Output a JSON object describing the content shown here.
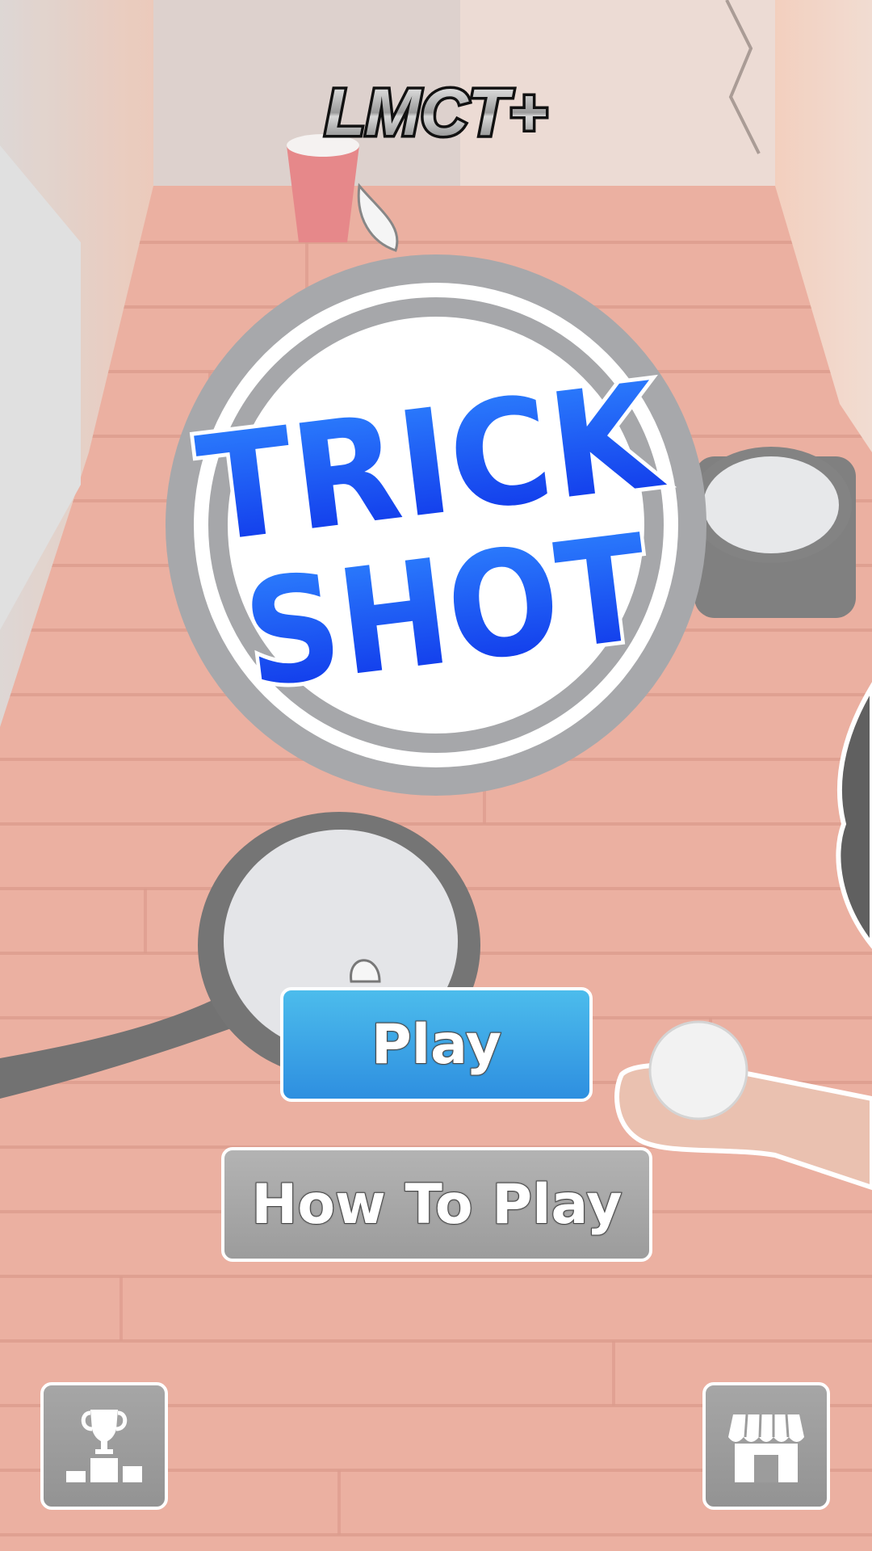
{
  "game": {
    "brand_logo": "LMCT+",
    "title_line1": "TRICK",
    "title_line2": "SHOT"
  },
  "menu": {
    "play_label": "Play",
    "how_to_play_label": "How To Play"
  },
  "corner_buttons": {
    "left_icon": "leaderboard-trophy-podium-icon",
    "right_icon": "store-shop-icon"
  },
  "colors": {
    "play_button": "#3aa3e6",
    "title_text": "#1e52f0",
    "secondary_button": "#a8a8a8",
    "floor": "#e7a08f"
  }
}
